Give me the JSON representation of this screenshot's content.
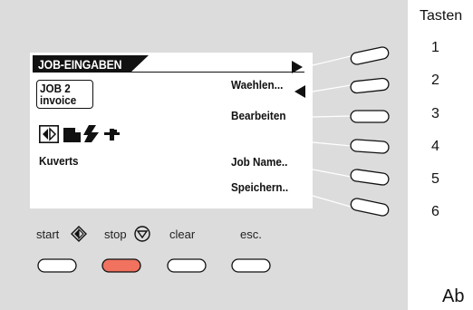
{
  "screen": {
    "title": "JOB-EINGABEN",
    "job_line1": "JOB   2",
    "job_line2": "invoice",
    "section_label": "Kuverts",
    "menu": {
      "waehlen": "Waehlen...",
      "bearbeiten": "Bearbeiten",
      "job_name": "Job Name..",
      "speichern": "Speichern.."
    }
  },
  "buttons": {
    "start": "start",
    "stop": "stop",
    "clear": "clear",
    "esc": "esc."
  },
  "colors": {
    "panel": "#dcdcdc",
    "stop_button": "#f0725f"
  },
  "legend": {
    "title": "Tasten",
    "numbers": [
      "1",
      "2",
      "3",
      "4",
      "5",
      "6"
    ]
  },
  "caption": "Ab"
}
